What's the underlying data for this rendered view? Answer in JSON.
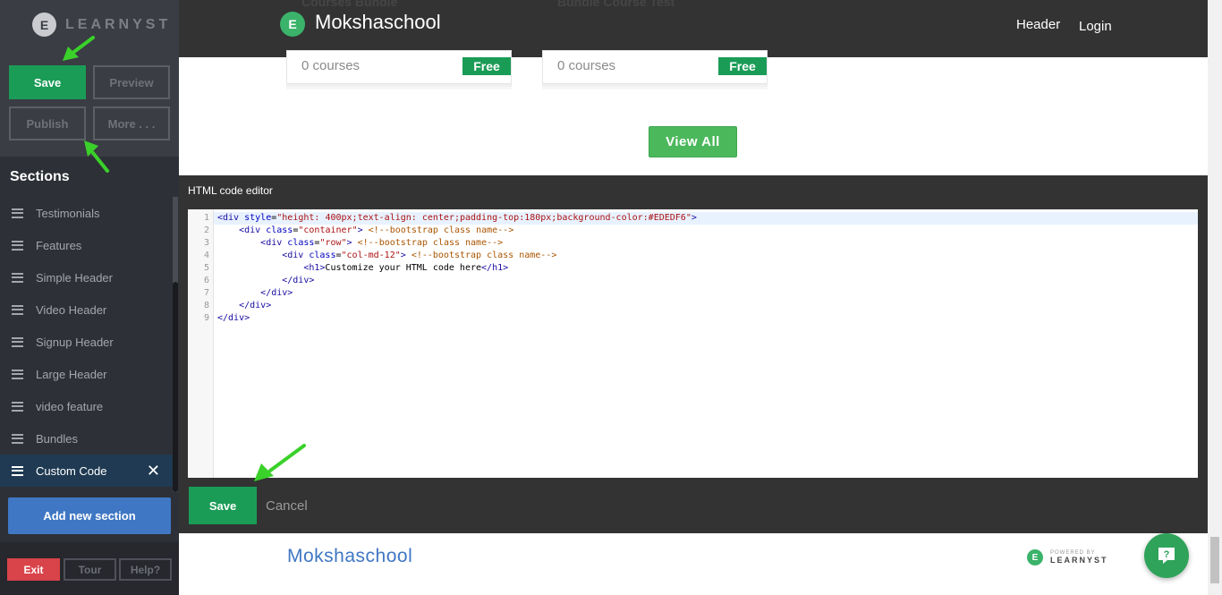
{
  "app": {
    "brand": "LEARNYST",
    "brand_icon": "learnyst-logo-icon"
  },
  "toolbar": {
    "save_label": "Save",
    "preview_label": "Preview",
    "publish_label": "Publish",
    "more_label": "More . . ."
  },
  "sidebar": {
    "title": "Sections",
    "items": [
      {
        "label": "Testimonials"
      },
      {
        "label": "Features"
      },
      {
        "label": "Simple Header"
      },
      {
        "label": "Video Header"
      },
      {
        "label": "Signup Header"
      },
      {
        "label": "Large Header"
      },
      {
        "label": "video feature"
      },
      {
        "label": "Bundles"
      },
      {
        "label": "Custom Code"
      }
    ],
    "add_section_label": "Add new section"
  },
  "bottom_bar": {
    "exit_label": "Exit",
    "tour_label": "Tour",
    "help_label": "Help?"
  },
  "site": {
    "name": "Mokshaschool",
    "nav_header": "Header",
    "nav_login": "Login",
    "course_cards": [
      {
        "title": "Courses Bundle",
        "count": "0 courses",
        "badge": "Free"
      },
      {
        "title": "Bundle Course Test",
        "count": "0 courses",
        "badge": "Free"
      }
    ],
    "view_all_label": "View All",
    "footer_name": "Mokshaschool",
    "powered_by": "POWERED BY",
    "powered_brand": "LEARNYST"
  },
  "editor": {
    "title": "HTML code editor",
    "line_numbers": [
      "1",
      "2",
      "3",
      "4",
      "5",
      "6",
      "7",
      "8",
      "9"
    ],
    "save_label": "Save",
    "cancel_label": "Cancel"
  },
  "colors": {
    "primary_green": "#1a9c57",
    "add_section_blue": "#3f77c4",
    "exit_red": "#d9434a",
    "annotation_arrow": "#3ad12a"
  }
}
